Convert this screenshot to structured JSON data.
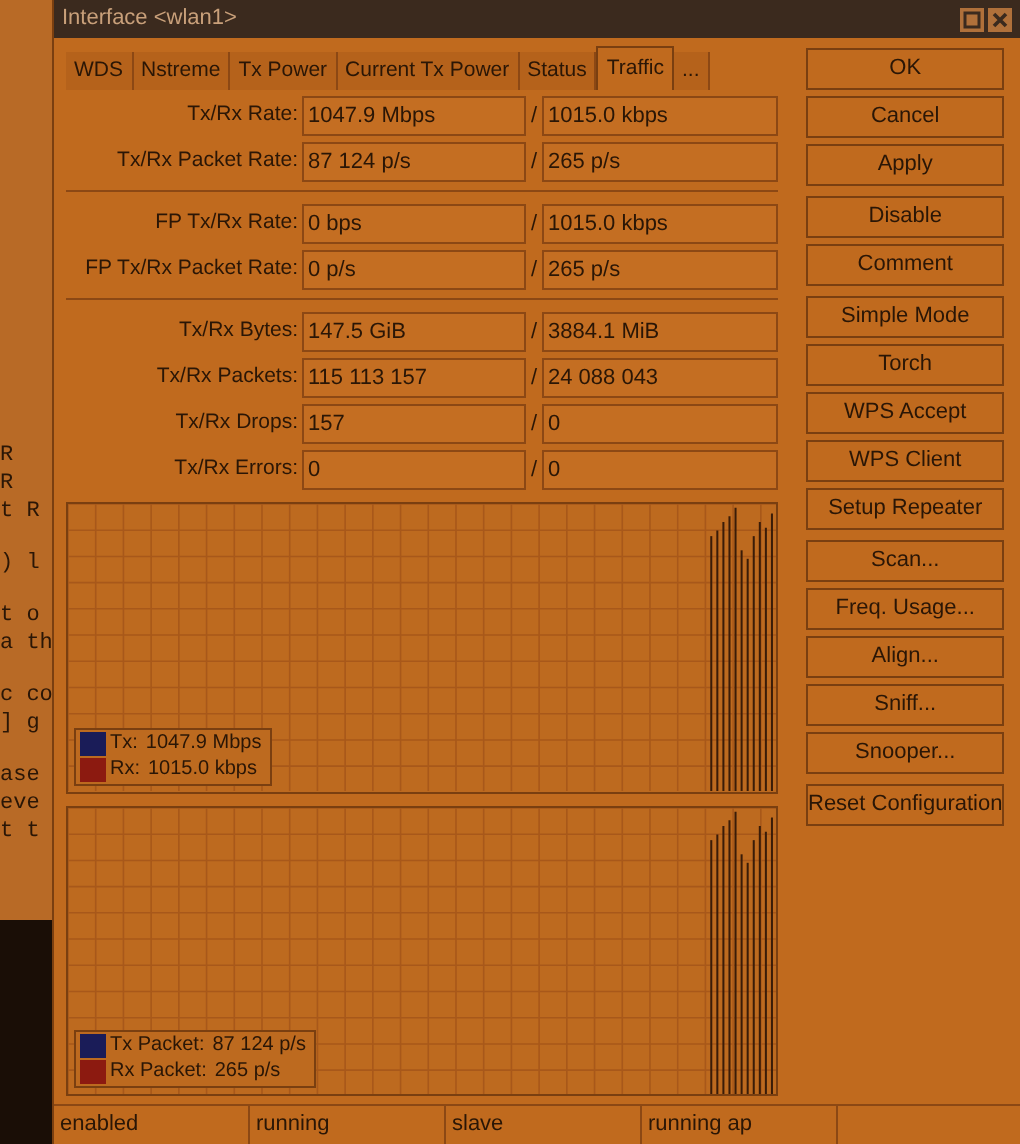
{
  "background_terminal": {
    "line_groups": [
      [
        "R",
        "R",
        "t R"
      ],
      [
        ") l"
      ],
      [
        "t o",
        "a th"
      ],
      [
        "c co",
        "] g"
      ],
      [
        "ase",
        "eve",
        "t t"
      ]
    ]
  },
  "window": {
    "title": "Interface <wlan1>"
  },
  "tabs": [
    {
      "label": "WDS",
      "selected": false
    },
    {
      "label": "Nstreme",
      "selected": false
    },
    {
      "label": "Tx Power",
      "selected": false
    },
    {
      "label": "Current Tx Power",
      "selected": false
    },
    {
      "label": "Status",
      "selected": false
    },
    {
      "label": "Traffic",
      "selected": true
    },
    {
      "label": "...",
      "selected": false
    }
  ],
  "field_groups": [
    [
      {
        "label": "Tx/Rx Rate:",
        "tx": "1047.9 Mbps",
        "separator": "/",
        "rx": "1015.0 kbps"
      },
      {
        "label": "Tx/Rx Packet Rate:",
        "tx": "87 124 p/s",
        "separator": "/",
        "rx": "265 p/s"
      }
    ],
    [
      {
        "label": "FP Tx/Rx Rate:",
        "tx": "0 bps",
        "separator": "/",
        "rx": "1015.0 kbps"
      },
      {
        "label": "FP Tx/Rx Packet Rate:",
        "tx": "0 p/s",
        "separator": "/",
        "rx": "265 p/s"
      }
    ],
    [
      {
        "label": "Tx/Rx Bytes:",
        "tx": "147.5 GiB",
        "separator": "/",
        "rx": "3884.1 MiB"
      },
      {
        "label": "Tx/Rx Packets:",
        "tx": "115 113 157",
        "separator": "/",
        "rx": "24 088 043"
      },
      {
        "label": "Tx/Rx Drops:",
        "tx": "157",
        "separator": "/",
        "rx": "0"
      },
      {
        "label": "Tx/Rx Errors:",
        "tx": "0",
        "separator": "/",
        "rx": "0"
      }
    ]
  ],
  "graphs": [
    {
      "legend": [
        {
          "label": "Tx:",
          "value": "1047.9 Mbps",
          "color": "#1a1c58"
        },
        {
          "label": "Rx:",
          "value": "1015.0 kbps",
          "color": "#8c1a10"
        }
      ]
    },
    {
      "legend": [
        {
          "label": "Tx Packet:",
          "value": "87 124 p/s",
          "color": "#1a1c58"
        },
        {
          "label": "Rx Packet:",
          "value": "265 p/s",
          "color": "#8c1a10"
        }
      ]
    }
  ],
  "button_groups": [
    [
      "OK",
      "Cancel",
      "Apply"
    ],
    [
      "Disable",
      "Comment"
    ],
    [
      "Simple Mode",
      "Torch",
      "WPS Accept",
      "WPS Client",
      "Setup Repeater"
    ],
    [
      "Scan...",
      "Freq. Usage...",
      "Align...",
      "Sniff...",
      "Snooper..."
    ],
    [
      "Reset Configuration"
    ]
  ],
  "status_bar": [
    "enabled",
    "running",
    "slave",
    "running ap"
  ]
}
